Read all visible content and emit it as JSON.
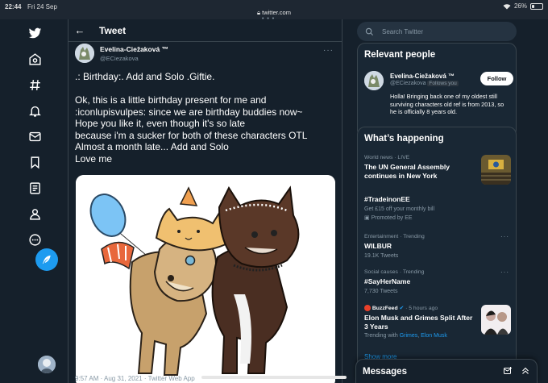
{
  "status_bar": {
    "time": "22:44",
    "date": "Fri 24 Sep",
    "url": "twitter.com",
    "battery": "26%",
    "battery_fraction": 0.26
  },
  "sidebar": {
    "items": [
      {
        "icon": "twitter-logo-icon"
      },
      {
        "icon": "home-icon"
      },
      {
        "icon": "explore-hashtag-icon"
      },
      {
        "icon": "notifications-bell-icon"
      },
      {
        "icon": "messages-envelope-icon"
      },
      {
        "icon": "bookmarks-icon"
      },
      {
        "icon": "lists-icon"
      },
      {
        "icon": "profile-icon"
      },
      {
        "icon": "more-icon"
      },
      {
        "icon": "compose-tweet-icon"
      }
    ]
  },
  "header": {
    "title": "Tweet"
  },
  "tweet": {
    "author_name": "Evelina-Ciežaková ™",
    "author_handle": "@ECiezakova",
    "lines": [
      ".: Birthday:. Add and Solo .Giftie.",
      "",
      "Ok, this is a little birthday present for me and",
      ":iconlupisvulpes: since we are birthday buddies now~",
      "Hope you like it, even though it's so late",
      "because i'm a sucker for both of these characters OTL",
      "Almost a month late... Add and Solo",
      "Love me"
    ],
    "meta": "9:57 AM · Aug 31, 2021 · Twitter Web App"
  },
  "search": {
    "placeholder": "Search Twitter"
  },
  "relevant": {
    "title": "Relevant people",
    "name": "Evelina-Ciežaková ™",
    "handle": "@ECiezakova",
    "follows_you": "Follows you",
    "follow_label": "Follow",
    "bio": "Holla! Bringing back one of my oldest still surviving characters old ref is from 2013, so he is officially 8 years old."
  },
  "happening": {
    "title": "What’s happening",
    "trends": [
      {
        "category": "World news · LIVE",
        "title": "The UN General Assembly continues in New York"
      },
      {
        "title": "#TradeinonEE",
        "subtitle": "Get £15 off your monthly bill",
        "promoted": "Promoted by EE"
      },
      {
        "category": "Entertainment · Trending",
        "title": "WILBUR",
        "count": "19.1K Tweets"
      },
      {
        "category": "Social causes · Trending",
        "title": "#SayHerName",
        "count": "7,730 Tweets"
      },
      {
        "source": "BuzzFeed",
        "time": " · 5 hours ago",
        "title": "Elon Musk and Grimes Split After 3 Years",
        "trending_prefix": "Trending with ",
        "trending_1": "Grimes",
        "trending_sep": ", ",
        "trending_2": "Elon Musk"
      }
    ],
    "show_more": "Show more"
  },
  "messages": {
    "title": "Messages"
  },
  "colors": {
    "background": "#15202b",
    "accent": "#1d9bf0",
    "card": "#192734",
    "border": "#38444d",
    "muted": "#8899a6"
  }
}
